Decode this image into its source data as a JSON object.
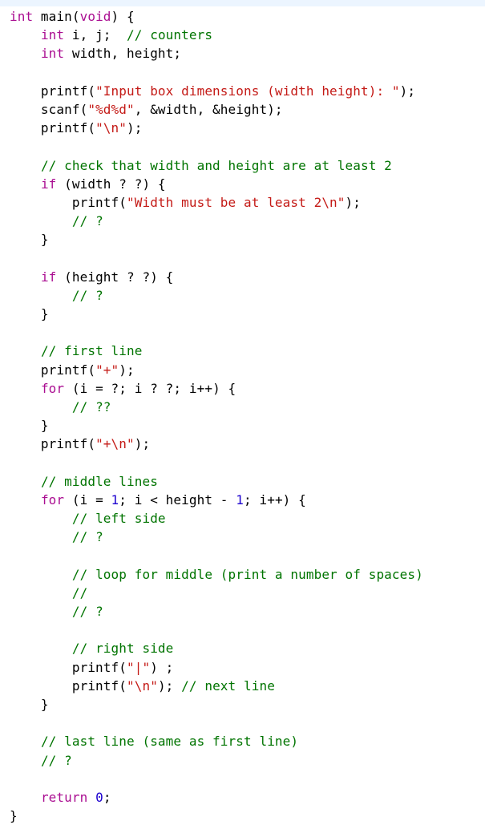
{
  "editor": {
    "language": "C",
    "colors": {
      "keyword": "#aa0d91",
      "string": "#c41a16",
      "comment": "#007400",
      "number": "#1c00cf",
      "plain": "#000000",
      "highlight_bar": "#ecf5ff"
    },
    "lines": [
      [
        {
          "t": "kw",
          "v": "int"
        },
        {
          "t": "plain",
          "v": " main("
        },
        {
          "t": "kw",
          "v": "void"
        },
        {
          "t": "plain",
          "v": ") {"
        }
      ],
      [
        {
          "t": "plain",
          "v": "    "
        },
        {
          "t": "kw",
          "v": "int"
        },
        {
          "t": "plain",
          "v": " i, j;  "
        },
        {
          "t": "cmt",
          "v": "// counters"
        }
      ],
      [
        {
          "t": "plain",
          "v": "    "
        },
        {
          "t": "kw",
          "v": "int"
        },
        {
          "t": "plain",
          "v": " width, height;"
        }
      ],
      [],
      [
        {
          "t": "plain",
          "v": "    printf("
        },
        {
          "t": "str",
          "v": "\"Input box dimensions (width height): \""
        },
        {
          "t": "plain",
          "v": ");"
        }
      ],
      [
        {
          "t": "plain",
          "v": "    scanf("
        },
        {
          "t": "str",
          "v": "\"%d%d\""
        },
        {
          "t": "plain",
          "v": ", &width, &height);"
        }
      ],
      [
        {
          "t": "plain",
          "v": "    printf("
        },
        {
          "t": "str",
          "v": "\"\\n\""
        },
        {
          "t": "plain",
          "v": ");"
        }
      ],
      [],
      [
        {
          "t": "plain",
          "v": "    "
        },
        {
          "t": "cmt",
          "v": "// check that width and height are at least 2"
        }
      ],
      [
        {
          "t": "plain",
          "v": "    "
        },
        {
          "t": "kw",
          "v": "if"
        },
        {
          "t": "plain",
          "v": " (width ? ?) {"
        }
      ],
      [
        {
          "t": "plain",
          "v": "        printf("
        },
        {
          "t": "str",
          "v": "\"Width must be at least 2\\n\""
        },
        {
          "t": "plain",
          "v": ");"
        }
      ],
      [
        {
          "t": "plain",
          "v": "        "
        },
        {
          "t": "cmt",
          "v": "// ?"
        }
      ],
      [
        {
          "t": "plain",
          "v": "    }"
        }
      ],
      [],
      [
        {
          "t": "plain",
          "v": "    "
        },
        {
          "t": "kw",
          "v": "if"
        },
        {
          "t": "plain",
          "v": " (height ? ?) {"
        }
      ],
      [
        {
          "t": "plain",
          "v": "        "
        },
        {
          "t": "cmt",
          "v": "// ?"
        }
      ],
      [
        {
          "t": "plain",
          "v": "    }"
        }
      ],
      [],
      [
        {
          "t": "plain",
          "v": "    "
        },
        {
          "t": "cmt",
          "v": "// first line"
        }
      ],
      [
        {
          "t": "plain",
          "v": "    printf("
        },
        {
          "t": "str",
          "v": "\"+\""
        },
        {
          "t": "plain",
          "v": ");"
        }
      ],
      [
        {
          "t": "plain",
          "v": "    "
        },
        {
          "t": "kw",
          "v": "for"
        },
        {
          "t": "plain",
          "v": " (i = ?; i ? ?; i++) {"
        }
      ],
      [
        {
          "t": "plain",
          "v": "        "
        },
        {
          "t": "cmt",
          "v": "// ??"
        }
      ],
      [
        {
          "t": "plain",
          "v": "    }"
        }
      ],
      [
        {
          "t": "plain",
          "v": "    printf("
        },
        {
          "t": "str",
          "v": "\"+\\n\""
        },
        {
          "t": "plain",
          "v": ");"
        }
      ],
      [],
      [
        {
          "t": "plain",
          "v": "    "
        },
        {
          "t": "cmt",
          "v": "// middle lines"
        }
      ],
      [
        {
          "t": "plain",
          "v": "    "
        },
        {
          "t": "kw",
          "v": "for"
        },
        {
          "t": "plain",
          "v": " (i = "
        },
        {
          "t": "num",
          "v": "1"
        },
        {
          "t": "plain",
          "v": "; i < height - "
        },
        {
          "t": "num",
          "v": "1"
        },
        {
          "t": "plain",
          "v": "; i++) {"
        }
      ],
      [
        {
          "t": "plain",
          "v": "        "
        },
        {
          "t": "cmt",
          "v": "// left side"
        }
      ],
      [
        {
          "t": "plain",
          "v": "        "
        },
        {
          "t": "cmt",
          "v": "// ?"
        }
      ],
      [],
      [
        {
          "t": "plain",
          "v": "        "
        },
        {
          "t": "cmt",
          "v": "// loop for middle (print a number of spaces)"
        }
      ],
      [
        {
          "t": "plain",
          "v": "        "
        },
        {
          "t": "cmt",
          "v": "//"
        }
      ],
      [
        {
          "t": "plain",
          "v": "        "
        },
        {
          "t": "cmt",
          "v": "// ?"
        }
      ],
      [],
      [
        {
          "t": "plain",
          "v": "        "
        },
        {
          "t": "cmt",
          "v": "// right side"
        }
      ],
      [
        {
          "t": "plain",
          "v": "        printf("
        },
        {
          "t": "str",
          "v": "\"|\""
        },
        {
          "t": "plain",
          "v": ") ;"
        }
      ],
      [
        {
          "t": "plain",
          "v": "        printf("
        },
        {
          "t": "str",
          "v": "\"\\n\""
        },
        {
          "t": "plain",
          "v": "); "
        },
        {
          "t": "cmt",
          "v": "// next line"
        }
      ],
      [
        {
          "t": "plain",
          "v": "    }"
        }
      ],
      [],
      [
        {
          "t": "plain",
          "v": "    "
        },
        {
          "t": "cmt",
          "v": "// last line (same as first line)"
        }
      ],
      [
        {
          "t": "plain",
          "v": "    "
        },
        {
          "t": "cmt",
          "v": "// ?"
        }
      ],
      [],
      [
        {
          "t": "plain",
          "v": "    "
        },
        {
          "t": "kw",
          "v": "return"
        },
        {
          "t": "plain",
          "v": " "
        },
        {
          "t": "num",
          "v": "0"
        },
        {
          "t": "plain",
          "v": ";"
        }
      ],
      [
        {
          "t": "plain",
          "v": "}"
        }
      ]
    ]
  }
}
